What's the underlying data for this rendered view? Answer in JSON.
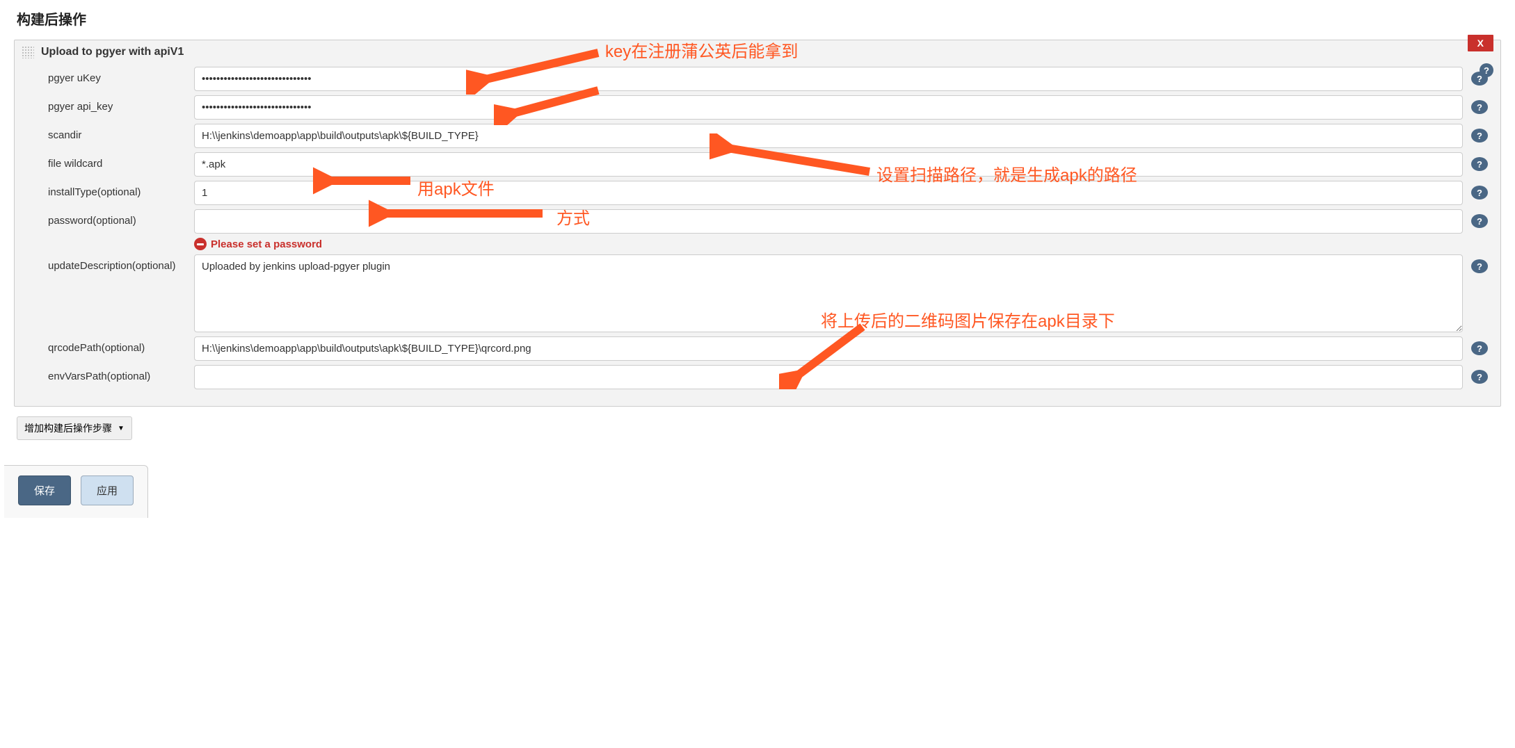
{
  "section_title": "构建后操作",
  "block": {
    "title": "Upload to pgyer with apiV1",
    "close_label": "X"
  },
  "fields": {
    "ukey_label": "pgyer uKey",
    "ukey_value": "••••••••••••••••••••••••••••••",
    "apikey_label": "pgyer api_key",
    "apikey_value": "••••••••••••••••••••••••••••••",
    "scandir_label": "scandir",
    "scandir_value": "H:\\\\jenkins\\demoapp\\app\\build\\outputs\\apk\\${BUILD_TYPE}",
    "wildcard_label": "file wildcard",
    "wildcard_value": "*.apk",
    "installtype_label": "installType(optional)",
    "installtype_value": "1",
    "password_label": "password(optional)",
    "password_value": "",
    "password_validation": "Please set a password",
    "desc_label": "updateDescription(optional)",
    "desc_value": "Uploaded by jenkins upload-pgyer plugin",
    "qrcode_label": "qrcodePath(optional)",
    "qrcode_value": "H:\\\\jenkins\\demoapp\\app\\build\\outputs\\apk\\${BUILD_TYPE}\\qrcord.png",
    "envvars_label": "envVarsPath(optional)",
    "envvars_value": ""
  },
  "add_step_label": "增加构建后操作步骤",
  "buttons": {
    "save": "保存",
    "apply": "应用"
  },
  "annotations": {
    "a1": "key在注册蒲公英后能拿到",
    "a2": "设置扫描路径，就是生成apk的路径",
    "a3_line1": "用apk文件",
    "a3_line2": "方式",
    "a4": "将上传后的二维码图片保存在apk目录下"
  }
}
